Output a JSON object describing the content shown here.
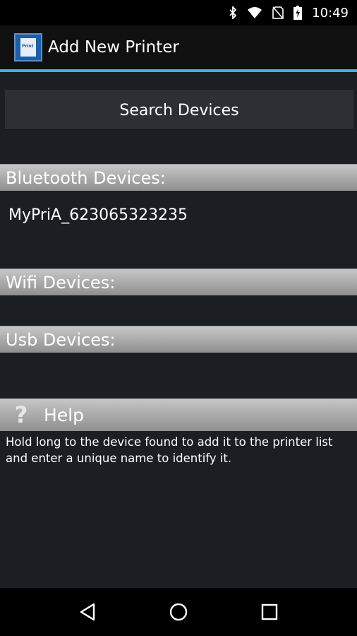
{
  "status_bar": {
    "time": "10:49",
    "icons": [
      "bluetooth-icon",
      "wifi-icon",
      "no-sim-icon",
      "battery-icon"
    ]
  },
  "action_bar": {
    "title": "Add New Printer",
    "app_icon_text": "Print"
  },
  "search_button": {
    "label": "Search Devices"
  },
  "sections": {
    "bluetooth": {
      "title": "Bluetooth Devices:",
      "devices": [
        "MyPriA_623065323235"
      ]
    },
    "wifi": {
      "title": "Wifi Devices:",
      "devices": []
    },
    "usb": {
      "title": "Usb Devices:",
      "devices": []
    }
  },
  "help": {
    "title": "Help",
    "icon": "question-mark-icon",
    "text_line1": "Hold long to the device found to add it to the printer list",
    "text_line2": "and enter a unique name to identify it."
  },
  "nav_bar": {
    "icons": [
      "back-icon",
      "home-icon",
      "recents-icon"
    ]
  },
  "colors": {
    "accent": "#33b5e5",
    "background": "#1b1e22",
    "header_gradient_top": "#c7c7c7",
    "header_gradient_bottom": "#8f8f8f"
  }
}
